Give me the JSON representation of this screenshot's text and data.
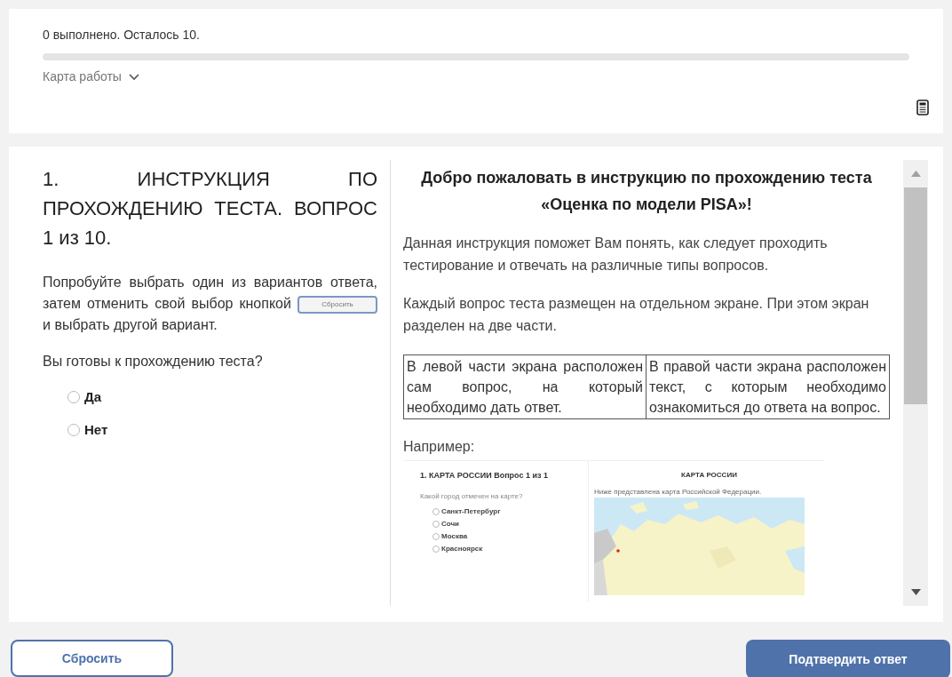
{
  "progress": {
    "text": "0 выполнено. Осталось 10.",
    "level": 0
  },
  "work_map": {
    "label": "Карта работы",
    "expanded": false
  },
  "question": {
    "title": "1. ИНСТРУКЦИЯ ПО ПРОХОЖДЕНИЮ ТЕСТА. ВОПРОС 1 из 10.",
    "text_before": "Попробуйте выбрать один из вариантов ответа, затем отменить свой выбор кнопкой",
    "inline_button": "Сбросить",
    "text_after": "и выбрать другой вариант.",
    "prompt": "Вы готовы к прохождению теста?",
    "options": [
      {
        "label": "Да",
        "selected": false
      },
      {
        "label": "Нет",
        "selected": false
      }
    ]
  },
  "content": {
    "heading": "Добро пожаловать в инструкцию по прохождению теста «Оценка по модели PISA»!",
    "paragraphs": [
      "Данная инструкция поможет Вам понять, как следует проходить тестирование и отвечать на различные типы вопросов.",
      "Каждый вопрос теста размещен на отдельном экране. При этом экран разделен на две части."
    ],
    "table": [
      "В левой части экрана расположен сам вопрос, на который необходимо дать ответ.",
      "В правой части экрана расположен текст, с которым необходимо ознакомиться до ответа на вопрос."
    ],
    "example_label": "Например:",
    "example": {
      "title": "1. КАРТА РОССИИ Вопрос 1 из 1",
      "prompt": "Какой город отмечен на карте?",
      "options": [
        {
          "label": "Санкт-Петербург",
          "selected": false
        },
        {
          "label": "Сочи",
          "selected": false
        },
        {
          "label": "Москва",
          "selected": false
        },
        {
          "label": "Красноярск",
          "selected": false
        }
      ],
      "right_heading": "КАРТА РОССИИ",
      "caption": "Ниже представлена карта Российской Федерации."
    }
  },
  "buttons": {
    "reset": "Сбросить",
    "submit": "Подтвердить ответ"
  }
}
